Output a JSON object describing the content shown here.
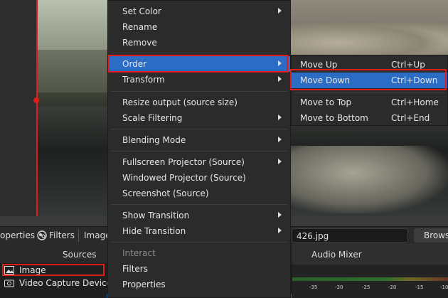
{
  "toolbar": {
    "properties_label": "operties",
    "filters_label": "Filters",
    "image_label": "Image",
    "file_value": "426.jpg",
    "browse_label": "Brows"
  },
  "docks": {
    "sources_title": "Sources",
    "mixer_title": "Audio Mixer"
  },
  "sources": [
    {
      "name": "Image",
      "icon": "image-icon"
    },
    {
      "name": "Video Capture Device",
      "icon": "camera-icon"
    }
  ],
  "mixer_ticks": [
    "-35",
    "-30",
    "-25",
    "-20",
    "-15",
    "-10"
  ],
  "context_menu": {
    "items": [
      {
        "label": "Set Color",
        "submenu": true
      },
      {
        "label": "Rename",
        "submenu": false
      },
      {
        "label": "Remove",
        "submenu": false
      },
      {
        "label": "Order",
        "submenu": true,
        "active": true
      },
      {
        "label": "Transform",
        "submenu": true
      },
      {
        "label": "Resize output (source size)",
        "submenu": false
      },
      {
        "label": "Scale Filtering",
        "submenu": true
      },
      {
        "label": "Blending Mode",
        "submenu": true
      },
      {
        "label": "Fullscreen Projector (Source)",
        "submenu": true
      },
      {
        "label": "Windowed Projector (Source)",
        "submenu": false
      },
      {
        "label": "Screenshot (Source)",
        "submenu": false
      },
      {
        "label": "Show Transition",
        "submenu": true
      },
      {
        "label": "Hide Transition",
        "submenu": true
      },
      {
        "label": "Interact",
        "submenu": false,
        "disabled": true
      },
      {
        "label": "Filters",
        "submenu": false
      },
      {
        "label": "Properties",
        "submenu": false
      }
    ]
  },
  "order_submenu": {
    "items": [
      {
        "label": "Move Up",
        "shortcut": "Ctrl+Up"
      },
      {
        "label": "Move Down",
        "shortcut": "Ctrl+Down",
        "active": true
      },
      {
        "label": "Move to Top",
        "shortcut": "Ctrl+Home"
      },
      {
        "label": "Move to Bottom",
        "shortcut": "Ctrl+End"
      }
    ]
  },
  "colors": {
    "menu_bg": "#2b2b2b",
    "highlight": "#2b6cc4",
    "annotation_red": "#e01b1b"
  }
}
